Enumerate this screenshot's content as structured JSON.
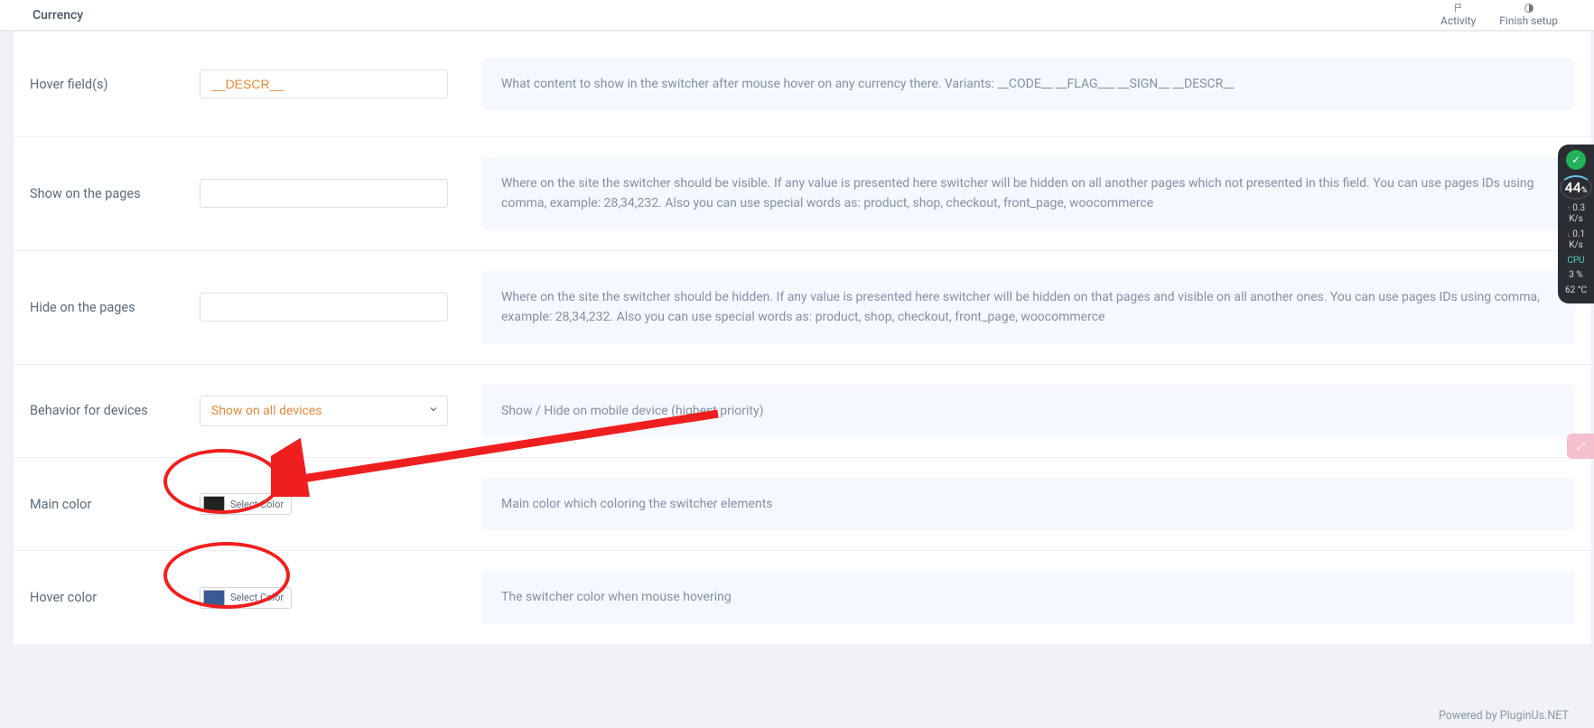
{
  "topbar": {
    "title": "Currency",
    "activity": "Activity",
    "finish": "Finish setup"
  },
  "rows": {
    "hover_fields": {
      "label": "Hover field(s)",
      "value": "__DESCR__",
      "desc": "What content to show in the switcher after mouse hover on any currency there. Variants: __CODE__ __FLAG___ __SIGN__ __DESCR__"
    },
    "show_pages": {
      "label": "Show on the pages",
      "value": "",
      "desc": "Where on the site the switcher should be visible. If any value is presented here switcher will be hidden on all another pages which not presented in this field. You can use pages IDs using comma, example: 28,34,232. Also you can use special words as: product, shop, checkout, front_page, woocommerce"
    },
    "hide_pages": {
      "label": "Hide on the pages",
      "value": "",
      "desc": "Where on the site the switcher should be hidden. If any value is presented here switcher will be hidden on that pages and visible on all another ones. You can use pages IDs using comma, example: 28,34,232. Also you can use special words as: product, shop, checkout, front_page, woocommerce"
    },
    "behavior": {
      "label": "Behavior for devices",
      "value": "Show on all devices",
      "desc": "Show / Hide on mobile device (highest priority)"
    },
    "main_color": {
      "label": "Main color",
      "button": "Select Color",
      "color": "#222222",
      "desc": "Main color which coloring the switcher elements"
    },
    "hover_color": {
      "label": "Hover color",
      "button": "Select Color",
      "color": "#3a5997",
      "desc": "The switcher color when mouse hovering"
    }
  },
  "footer": "Powered by PluginUs.NET",
  "sysmon": {
    "pct": "44",
    "pct_unit": "%",
    "up": "0.3",
    "down": "0.1",
    "rate_unit": "K/s",
    "cpu_label": "CPU",
    "cpu_val": "3  %",
    "temp": "62 °C"
  }
}
